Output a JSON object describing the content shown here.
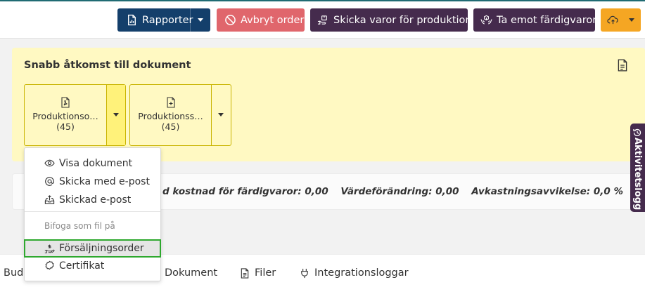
{
  "toolbar": {
    "rapporter_label": "Rapporter",
    "avbryt_label": "Avbryt order",
    "skicka_label": "Skicka varor för produktion",
    "taemot_label": "Ta emot färdigvaror"
  },
  "quick_access": {
    "title": "Snabb åtkomst till dokument",
    "documents": [
      {
        "name": "Produktionso…",
        "count": "(45)"
      },
      {
        "name": "Produktionss…",
        "count": "(45)"
      }
    ]
  },
  "summary": {
    "cost": "d kostnad för färdigvaror: 0,00",
    "change": "Värdeförändring: 0,00",
    "deviation": "Avkastningsavvikelse: 0,0 %"
  },
  "side_tab": {
    "label": "Aktivitetslogg"
  },
  "menu": {
    "items": [
      {
        "label": "Visa dokument"
      },
      {
        "label": "Skicka med e-post"
      },
      {
        "label": "Skickad e-post"
      }
    ],
    "attach_header": "Bifoga som fil på",
    "attach_items": [
      {
        "label": "Försäljningsorder"
      },
      {
        "label": "Certifikat"
      }
    ]
  },
  "tabs": {
    "budg": "Budg",
    "dokument": "Dokument",
    "filer": "Filer",
    "integrationsloggar": "Integrationsloggar"
  },
  "colors": {
    "primary": "#143f6b",
    "danger": "#e0666c",
    "purple": "#452b4d",
    "warning": "#f5a623",
    "highlight": "#fff9c2",
    "selected_border": "#2ea82e"
  }
}
